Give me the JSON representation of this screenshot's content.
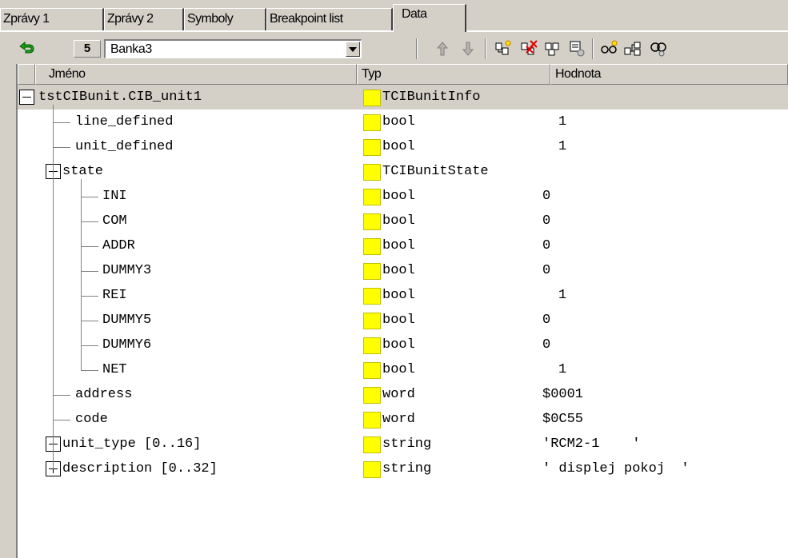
{
  "tabs": [
    {
      "label": "Zprávy 1",
      "active": false
    },
    {
      "label": "Zprávy 2",
      "active": false
    },
    {
      "label": "Symboly",
      "active": false
    },
    {
      "label": "Breakpoint list",
      "active": false
    },
    {
      "label": "Data",
      "active": true
    }
  ],
  "toolbar": {
    "bank_number": "5",
    "bank_value": "Banka3"
  },
  "columns": {
    "name": "Jméno",
    "type": "Typ",
    "value": "Hodnota"
  },
  "rows": [
    {
      "name": "tstCIBunit.CIB_unit1",
      "type": "TCIBunitInfo",
      "value": "",
      "level": 0,
      "expander": "minus",
      "selected": true
    },
    {
      "name": "line_defined",
      "type": "bool",
      "value": "1",
      "level": 1,
      "expander": "none"
    },
    {
      "name": "unit_defined",
      "type": "bool",
      "value": "1",
      "level": 1,
      "expander": "none"
    },
    {
      "name": "state",
      "type": "TCIBunitState",
      "value": "",
      "level": 1,
      "expander": "minus"
    },
    {
      "name": "INI",
      "type": "bool",
      "value": "0",
      "level": 2,
      "expander": "none"
    },
    {
      "name": "COM",
      "type": "bool",
      "value": "0",
      "level": 2,
      "expander": "none"
    },
    {
      "name": "ADDR",
      "type": "bool",
      "value": "0",
      "level": 2,
      "expander": "none"
    },
    {
      "name": "DUMMY3",
      "type": "bool",
      "value": "0",
      "level": 2,
      "expander": "none"
    },
    {
      "name": "REI",
      "type": "bool",
      "value": "1",
      "level": 2,
      "expander": "none"
    },
    {
      "name": "DUMMY5",
      "type": "bool",
      "value": "0",
      "level": 2,
      "expander": "none"
    },
    {
      "name": "DUMMY6",
      "type": "bool",
      "value": "0",
      "level": 2,
      "expander": "none"
    },
    {
      "name": "NET",
      "type": "bool",
      "value": "1",
      "level": 2,
      "expander": "none"
    },
    {
      "name": "address",
      "type": "word",
      "value": "$0001",
      "level": 1,
      "expander": "none"
    },
    {
      "name": "code",
      "type": "word",
      "value": "$0C55",
      "level": 1,
      "expander": "none"
    },
    {
      "name": "unit_type [0..16]",
      "type": "string",
      "value": "'RCM2-1    '",
      "level": 1,
      "expander": "plus"
    },
    {
      "name": "description [0..32]",
      "type": "string",
      "value": "' displej pokoj  '",
      "level": 1,
      "expander": "plus"
    }
  ],
  "colors": {
    "chrome": "#d4d0c8",
    "type_swatch": "#ffff00",
    "tree_lines": "#808080"
  },
  "icons": [
    "back-arrow-icon",
    "move-up-icon",
    "move-down-icon",
    "add-watch-icon",
    "delete-watch-icon",
    "watch-list-icon",
    "edit-watch-icon",
    "glasses-icon",
    "tree-icon",
    "settings-icon"
  ]
}
